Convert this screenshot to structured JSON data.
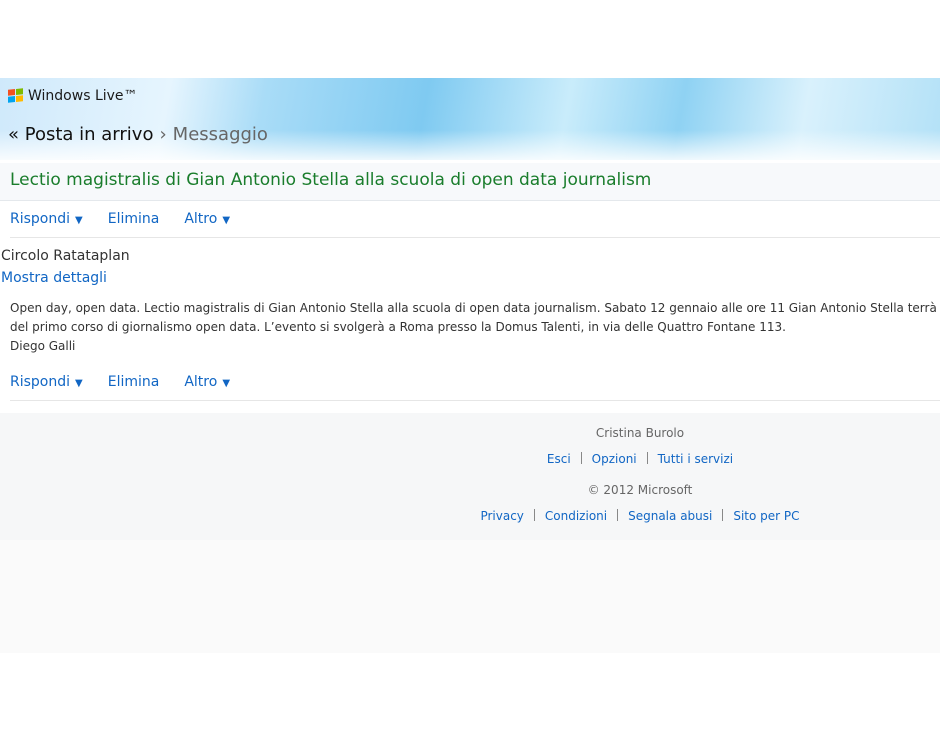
{
  "header": {
    "brand": "Windows Live™",
    "back_link": "« Posta in arrivo",
    "separator": "›",
    "current": "Messaggio"
  },
  "message": {
    "subject": "Lectio magistralis di Gian Antonio Stella alla scuola di open data journalism",
    "sender": "Circolo Ratataplan",
    "details_link": "Mostra dettagli",
    "body_lines": [
      "Open day, open data. Lectio magistralis di Gian Antonio Stella alla scuola di open data journalism. Sabato 12 gennaio alle ore 11 Gian Antonio Stella terrà una lectio magistralis",
      "del primo corso di giornalismo open data. L’evento si svolgerà a Roma presso la Domus Talenti, in via delle Quattro Fontane 113.",
      "Diego Galli"
    ]
  },
  "actions": {
    "reply": "Rispondi",
    "delete": "Elimina",
    "more": "Altro",
    "dropdown_glyph": "▼"
  },
  "footer": {
    "user": "Cristina Burolo",
    "links_top": [
      "Esci",
      "Opzioni",
      "Tutti i servizi"
    ],
    "copyright": "© 2012 Microsoft",
    "links_bottom": [
      "Privacy",
      "Condizioni",
      "Segnala abusi",
      "Sito per PC"
    ]
  },
  "colors": {
    "link": "#1166c4",
    "subject": "#1a7d2c"
  },
  "icons": {
    "brand_logo": "windows-flag-icon"
  }
}
